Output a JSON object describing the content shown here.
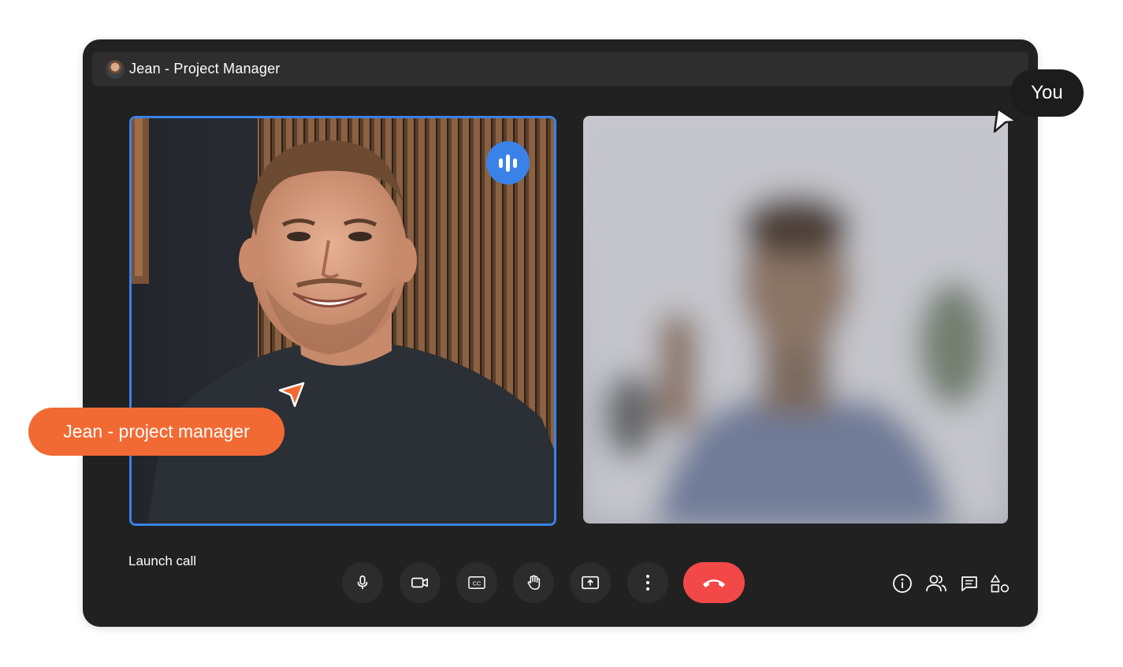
{
  "window": {
    "title": "Jean - Project Manager",
    "avatar_icon": "user-avatar"
  },
  "participants": {
    "main": {
      "name": "Jean",
      "speaking_icon": "audio-waves-icon",
      "accent": "#3b82e8"
    },
    "self": {
      "blurred": true
    }
  },
  "footer": {
    "launch_label": "Launch call"
  },
  "controls": [
    {
      "name": "microphone-icon"
    },
    {
      "name": "camera-icon"
    },
    {
      "name": "closed-captions-icon"
    },
    {
      "name": "raise-hand-icon"
    },
    {
      "name": "present-screen-icon"
    },
    {
      "name": "more-options-icon"
    },
    {
      "name": "end-call-icon",
      "color": "#f24848"
    }
  ],
  "side_icons": [
    {
      "name": "info-icon"
    },
    {
      "name": "people-icon"
    },
    {
      "name": "chat-icon"
    },
    {
      "name": "activities-icon"
    }
  ],
  "cursors": {
    "self": {
      "label": "You",
      "color": "#1c1c1c"
    },
    "jean": {
      "label": "Jean - project manager",
      "color": "#f26a33"
    }
  }
}
